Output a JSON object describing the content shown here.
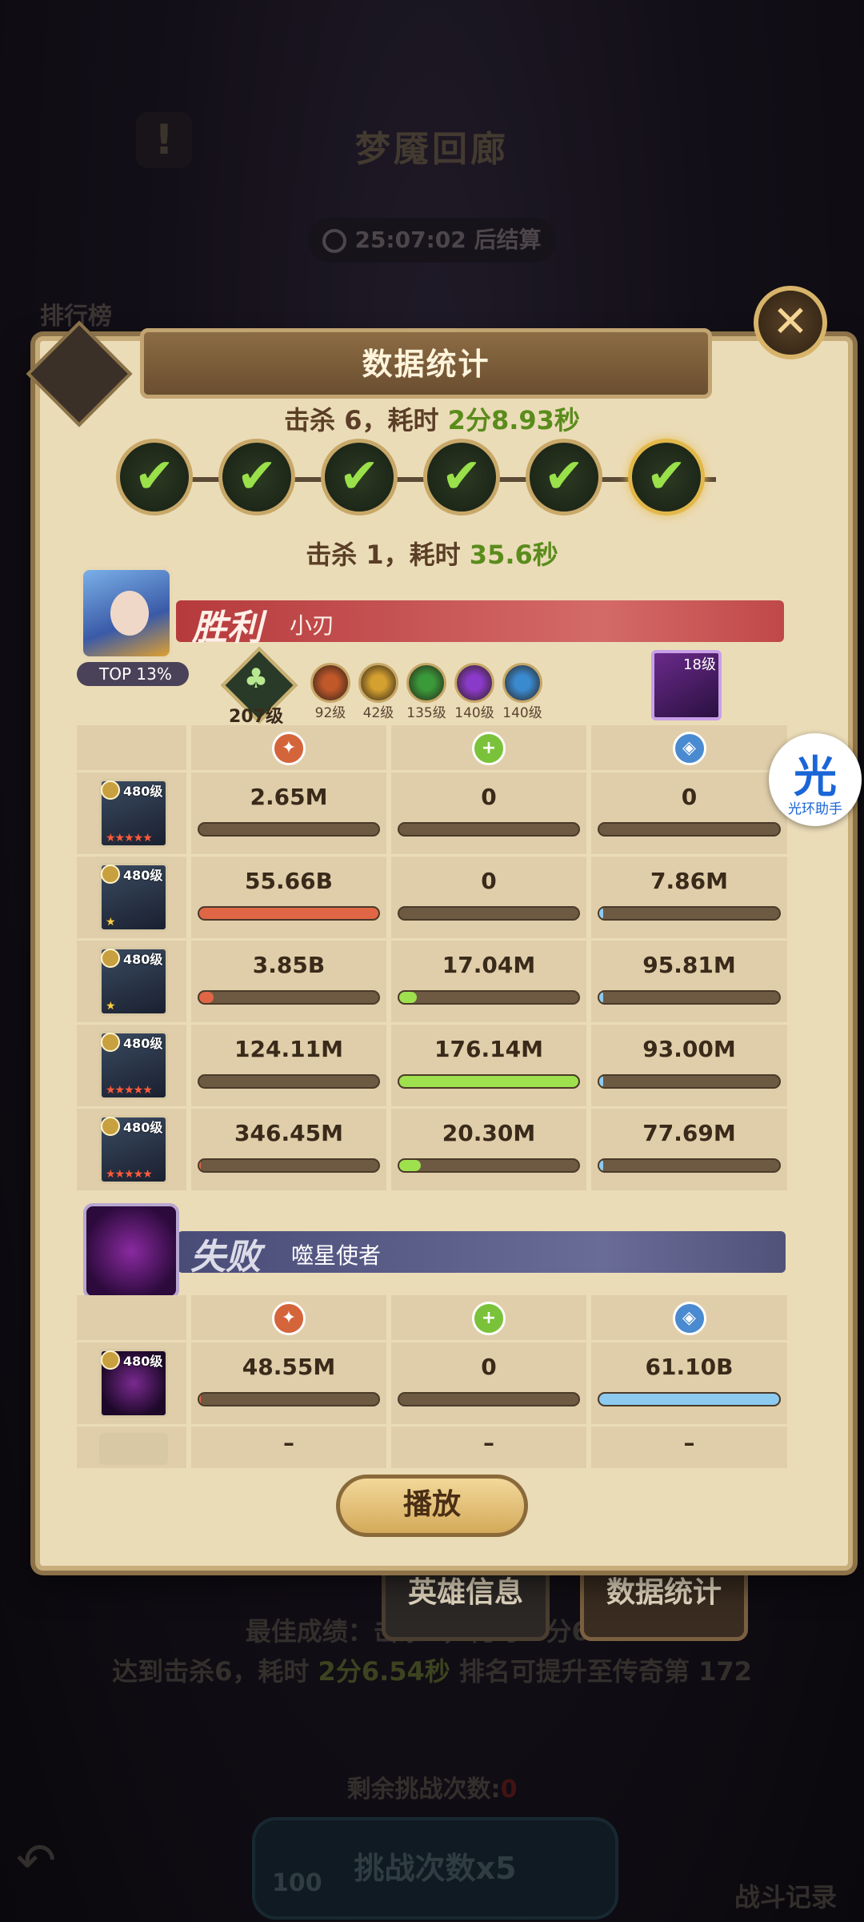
{
  "background": {
    "title": "梦魇回廊",
    "timer": "25:07:02 后结算",
    "ranking_label": "排行榜",
    "best_prefix": "最佳成绩：击杀",
    "best_kills": "6",
    "best_suffix": "，耗时 2分6...",
    "reach_line_prefix": "达到击杀",
    "reach_kills": "6",
    "reach_mid": "，耗时 ",
    "reach_time": "2分6.54秒",
    "reach_suffix": " 排名可提升至传奇第 ",
    "reach_rank": "172",
    "remaining_label": "剩余挑战次数:",
    "remaining_count": "0",
    "challenge_label": "挑战次数x5",
    "challenge_cost": "100",
    "battle_log_label": "战斗记录"
  },
  "tabs": {
    "hero_info": "英雄信息",
    "data_stats": "数据统计"
  },
  "panel": {
    "title": "数据统计",
    "summary_total_prefix": "击杀",
    "summary_total_kills": "6",
    "summary_total_mid": "，耗时",
    "summary_total_time": "2分8.93秒",
    "summary_round_prefix": "击杀",
    "summary_round_kills": "1",
    "summary_round_mid": "，耗时",
    "summary_round_time": "35.6秒",
    "stages_count": 6,
    "play_button": "播放"
  },
  "victory": {
    "result": "胜利",
    "player_name": "小刃",
    "top_badge": "TOP 13%",
    "tree_level": "207级",
    "orbs": [
      {
        "level": "92级",
        "color": "#c0582a"
      },
      {
        "level": "42级",
        "color": "#d4a030"
      },
      {
        "level": "135级",
        "color": "#3a9a3a"
      },
      {
        "level": "140级",
        "color": "#8a3ac8"
      },
      {
        "level": "140级",
        "color": "#3a8ad0"
      }
    ],
    "pet_level": "18级",
    "heroes": [
      {
        "level": "480级",
        "stars": "★★★★★",
        "damage": "2.65M",
        "heal": "0",
        "defense": "0",
        "damage_pct": 0,
        "heal_pct": 0,
        "defense_pct": 0
      },
      {
        "level": "480级",
        "stars": "★",
        "damage": "55.66B",
        "heal": "0",
        "defense": "7.86M",
        "damage_pct": 100,
        "heal_pct": 0,
        "defense_pct": 2
      },
      {
        "level": "480级",
        "stars": "★",
        "damage": "3.85B",
        "heal": "17.04M",
        "defense": "95.81M",
        "damage_pct": 8,
        "heal_pct": 10,
        "defense_pct": 2
      },
      {
        "level": "480级",
        "stars": "★★★★★",
        "damage": "124.11M",
        "heal": "176.14M",
        "defense": "93.00M",
        "damage_pct": 0,
        "heal_pct": 100,
        "defense_pct": 2
      },
      {
        "level": "480级",
        "stars": "★★★★★",
        "damage": "346.45M",
        "heal": "20.30M",
        "defense": "77.69M",
        "damage_pct": 1,
        "heal_pct": 12,
        "defense_pct": 2
      }
    ]
  },
  "defeat": {
    "result": "失败",
    "enemy_name": "噬星使者",
    "units": [
      {
        "level": "480级",
        "damage": "48.55M",
        "heal": "0",
        "defense": "61.10B",
        "damage_pct": 1,
        "heal_pct": 0,
        "defense_pct": 100
      },
      {
        "level": "",
        "damage": "–",
        "heal": "–",
        "defense": "–"
      }
    ]
  },
  "assistant": {
    "glyph": "光",
    "label": "光环助手"
  }
}
